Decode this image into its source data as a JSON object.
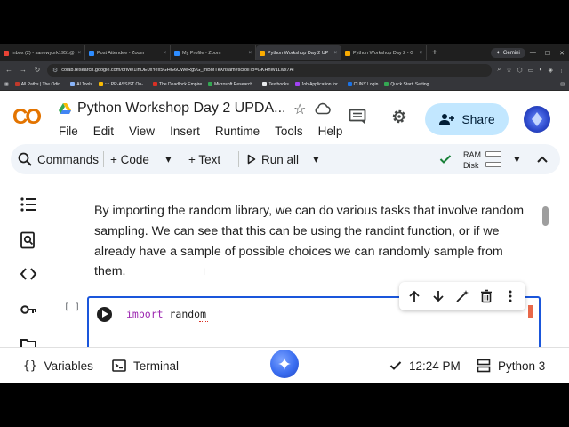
{
  "browser": {
    "tabs": [
      {
        "label": "Inbox (2) - sanewyork1951@",
        "color": "#ea4335",
        "active": false
      },
      {
        "label": "Post Attendee - Zoom",
        "color": "#2d8cff",
        "active": false
      },
      {
        "label": "My Profile - Zoom",
        "color": "#2d8cff",
        "active": false
      },
      {
        "label": "Python Workshop Day 2 UP",
        "color": "#f9ab00",
        "active": true
      },
      {
        "label": "Python Workshop Day 2 - G",
        "color": "#f9ab00",
        "active": false
      }
    ],
    "gemini_label": "Gemini",
    "url": "colab.research.google.com/drive/1lhOE0xYex5GHG6UWeRg9G_mBMTkXhsam#scrollTo=GKHhW1Lwx7Al",
    "bookmarks": [
      {
        "label": "All Paths | The Odin...",
        "color": "#c0392b"
      },
      {
        "label": "AI Tools",
        "color": "#8ab4f8"
      },
      {
        "label": ":::: PR-ASSIST On-...",
        "color": "#fbbc04"
      },
      {
        "label": "The Deadlock Empire",
        "color": "#d93025"
      },
      {
        "label": "Microsoft Research...",
        "color": "#34a853"
      },
      {
        "label": "Textbooks",
        "color": "#e8eaed"
      },
      {
        "label": "Job Application for...",
        "color": "#a142f4"
      },
      {
        "label": "CUNY Login",
        "color": "#1a73e8"
      },
      {
        "label": "Quick Start: Setting...",
        "color": "#34a853"
      }
    ],
    "all_bookmarks_icon": "bookmark-folder-icon"
  },
  "colab": {
    "logo_text": "CO",
    "title": "Python Workshop Day 2 UPDA...",
    "menu": [
      "File",
      "Edit",
      "View",
      "Insert",
      "Runtime",
      "Tools",
      "Help"
    ],
    "share_label": "Share",
    "toolbar": {
      "commands_label": "Commands",
      "code_label": "+ Code",
      "text_label": "+ Text",
      "run_all_label": "Run all",
      "ram_label": "RAM",
      "disk_label": "Disk"
    },
    "text_cell": "By importing the random library, we can do various tasks that involve random sampling. We can see that this can be using the randint function, or if we already have a sample of possible choices we can randomly sample from them.",
    "code_cell": {
      "bracket": "[ ]",
      "keyword": "import",
      "module": " random"
    },
    "statusbar": {
      "variables_label": "Variables",
      "terminal_label": "Terminal",
      "time": "12:24 PM",
      "runtime": "Python 3"
    }
  },
  "colors": {
    "accent": "#1a56db",
    "share_bg": "#c2e7ff",
    "toolbar_bg": "#f0f4f9",
    "logo_orange": "#f9ab00"
  }
}
